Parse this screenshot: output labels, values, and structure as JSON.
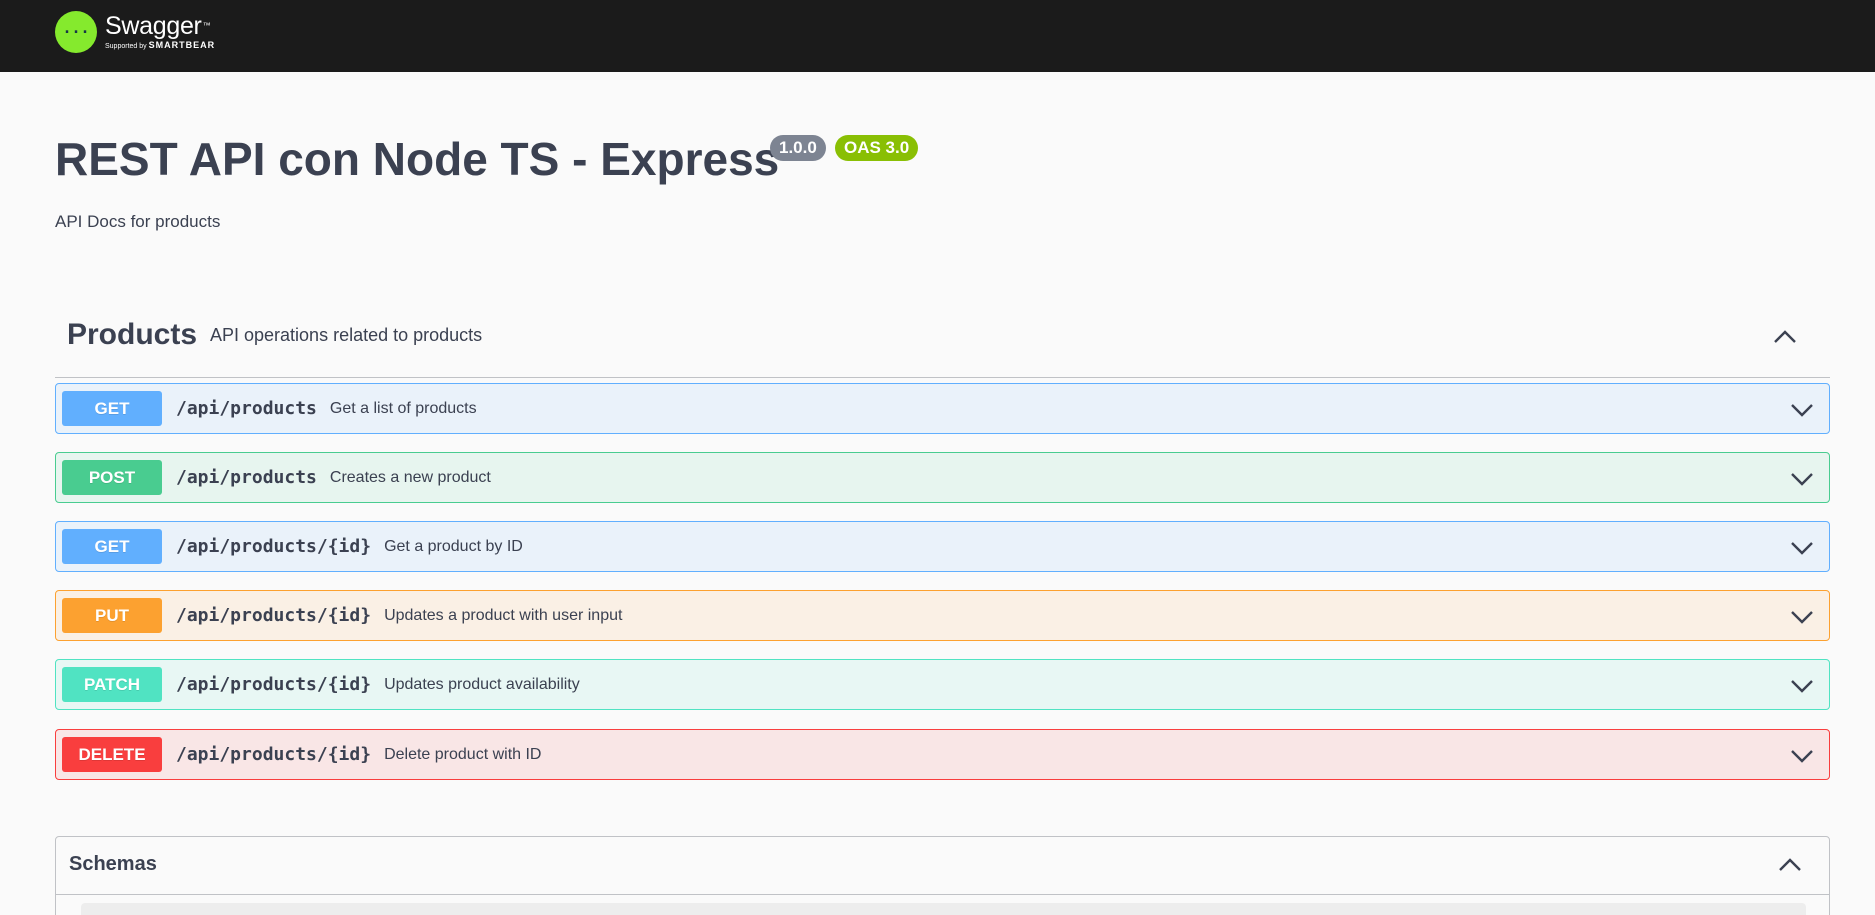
{
  "topbar": {
    "logo_name": "Swagger",
    "logo_tm": "™",
    "logo_supported_by": "Supported by",
    "logo_company": "SMARTBEAR",
    "logo_mark_icon": "curly-braces-logo-icon"
  },
  "info": {
    "title": "REST API con Node TS - Express",
    "version": "1.0.0",
    "oas": "OAS 3.0",
    "description": "API Docs for products"
  },
  "tag": {
    "name": "Products",
    "description": "API operations related to products",
    "toggle_icon": "chevron-up-icon"
  },
  "operations": [
    {
      "method": "GET",
      "path": "/api/products",
      "summary": "Get a list of products",
      "color": "#61affe"
    },
    {
      "method": "POST",
      "path": "/api/products",
      "summary": "Creates a new product",
      "color": "#49cc90"
    },
    {
      "method": "GET",
      "path": "/api/products/{id}",
      "summary": "Get a product by ID",
      "color": "#61affe"
    },
    {
      "method": "PUT",
      "path": "/api/products/{id}",
      "summary": "Updates a product with user input",
      "color": "#fca130"
    },
    {
      "method": "PATCH",
      "path": "/api/products/{id}",
      "summary": "Updates product availability",
      "color": "#50e3c2"
    },
    {
      "method": "DELETE",
      "path": "/api/products/{id}",
      "summary": "Delete product with ID",
      "color": "#f93e3e"
    }
  ],
  "schemas": {
    "title": "Schemas",
    "toggle_icon": "chevron-up-icon"
  }
}
